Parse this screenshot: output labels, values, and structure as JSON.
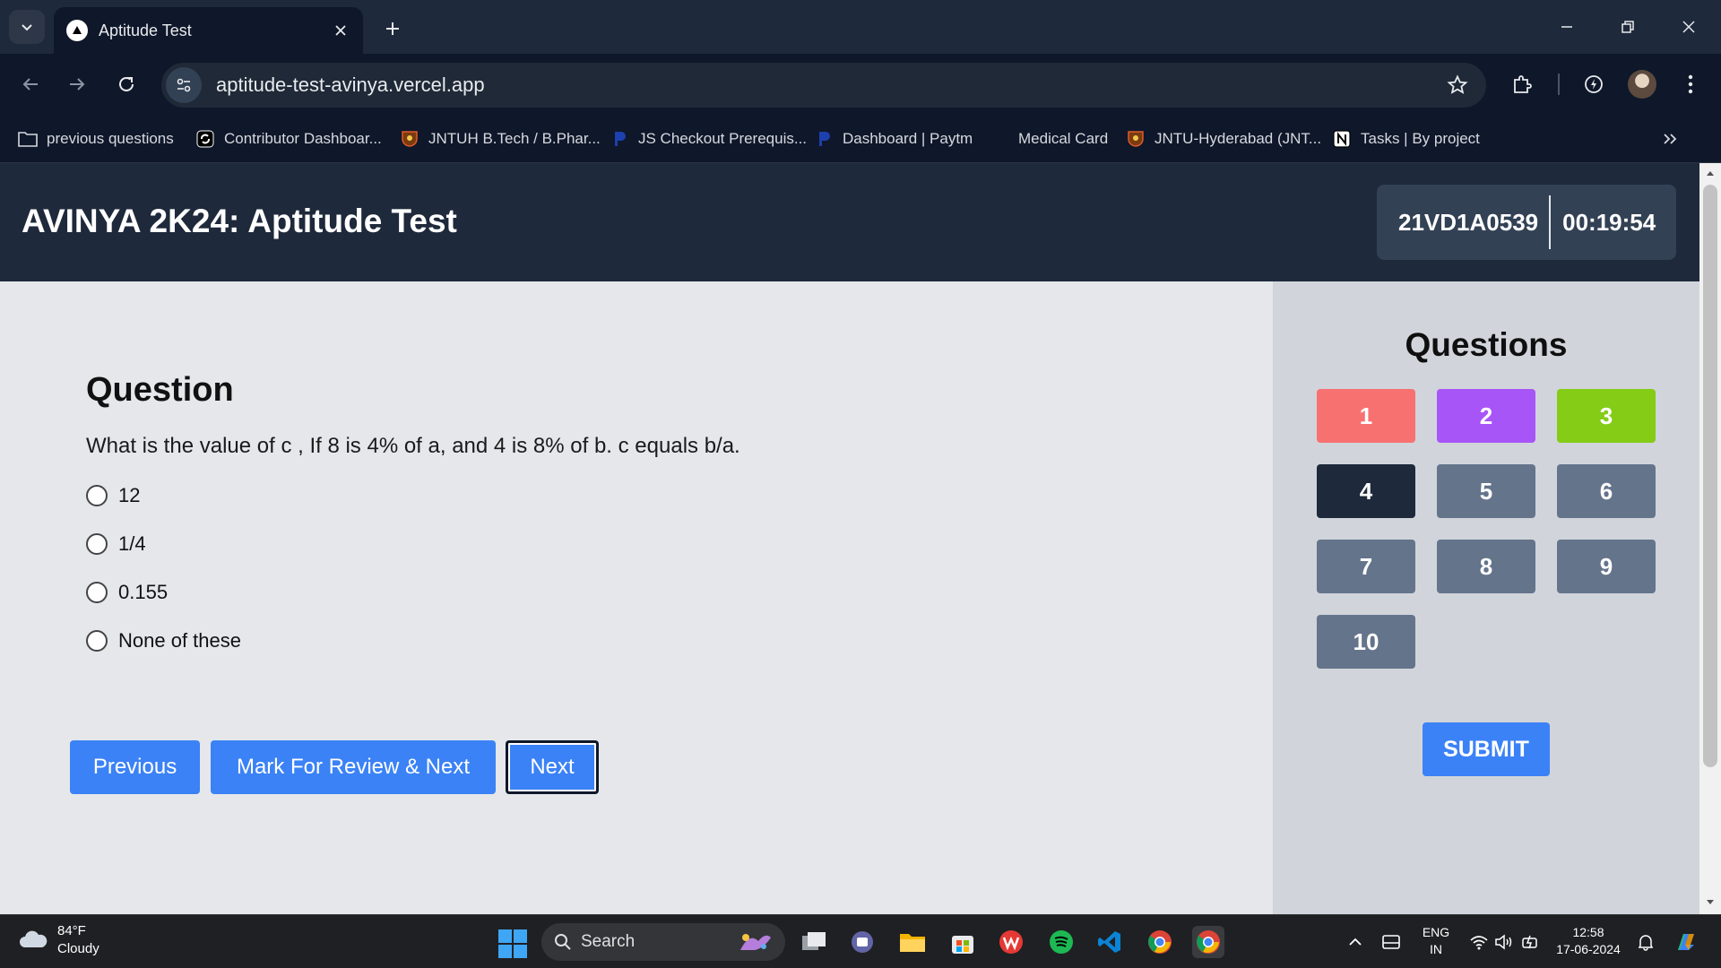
{
  "browser": {
    "tab_title": "Aptitude Test",
    "url": "aptitude-test-avinya.vercel.app",
    "bookmarks": [
      {
        "label": "previous questions",
        "icon": "folder-icon"
      },
      {
        "label": "Contributor Dashboar...",
        "icon": "contributor-icon"
      },
      {
        "label": "JNTUH B.Tech / B.Phar...",
        "icon": "jntuh-crest-icon"
      },
      {
        "label": "JS Checkout Prerequis...",
        "icon": "paytm-icon"
      },
      {
        "label": "Dashboard | Paytm",
        "icon": "paytm-icon"
      },
      {
        "label": "Medical Card",
        "icon": "blank-page-icon"
      },
      {
        "label": "JNTU-Hyderabad (JNT...",
        "icon": "jntuh-crest-icon"
      },
      {
        "label": "Tasks | By project",
        "icon": "notion-icon"
      }
    ]
  },
  "header": {
    "title": "AVINYA 2K24: Aptitude Test",
    "roll_number": "21VD1A0539",
    "timer": "00:19:54"
  },
  "question": {
    "heading": "Question",
    "text": "What is the value of c , If 8 is 4% of a, and 4 is 8% of b. c equals b/a.",
    "options": [
      "12",
      "1/4",
      "0.155",
      "None of these"
    ]
  },
  "buttons": {
    "previous": "Previous",
    "mark_review": "Mark For Review & Next",
    "next": "Next",
    "submit": "SUBMIT"
  },
  "sidepanel": {
    "title": "Questions",
    "questions": [
      {
        "num": "1",
        "status": "not-answered",
        "color": "#f87171"
      },
      {
        "num": "2",
        "status": "marked-for-review",
        "color": "#a855f7"
      },
      {
        "num": "3",
        "status": "answered",
        "color": "#84cc16"
      },
      {
        "num": "4",
        "status": "current",
        "color": "#1e293b"
      },
      {
        "num": "5",
        "status": "not-visited",
        "color": "#64748b"
      },
      {
        "num": "6",
        "status": "not-visited",
        "color": "#64748b"
      },
      {
        "num": "7",
        "status": "not-visited",
        "color": "#64748b"
      },
      {
        "num": "8",
        "status": "not-visited",
        "color": "#64748b"
      },
      {
        "num": "9",
        "status": "not-visited",
        "color": "#64748b"
      },
      {
        "num": "10",
        "status": "not-visited",
        "color": "#64748b"
      }
    ]
  },
  "taskbar": {
    "temperature": "84°F",
    "condition": "Cloudy",
    "search_label": "Search",
    "lang_line1": "ENG",
    "lang_line2": "IN",
    "time": "12:58",
    "date": "17-06-2024"
  }
}
